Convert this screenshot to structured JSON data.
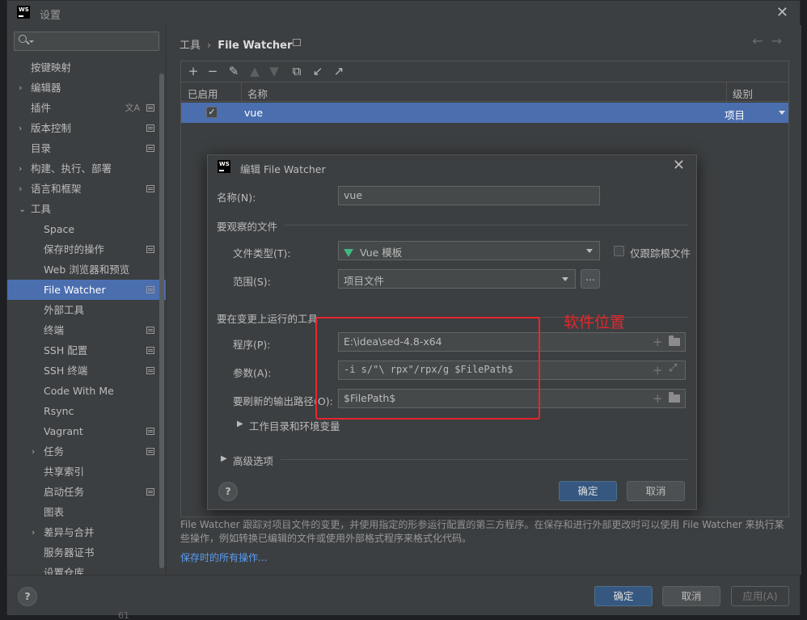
{
  "window": {
    "title": "设置",
    "logo_text": "WS"
  },
  "sidebar": {
    "search_placeholder": "",
    "items": [
      {
        "label": "按键映射",
        "level": 0,
        "arrow": "",
        "project": false
      },
      {
        "label": "编辑器",
        "level": 0,
        "arrow": "›",
        "project": false
      },
      {
        "label": "插件",
        "level": 0,
        "arrow": "",
        "project": true,
        "translate": "文A"
      },
      {
        "label": "版本控制",
        "level": 0,
        "arrow": "›",
        "project": true
      },
      {
        "label": "目录",
        "level": 0,
        "arrow": "",
        "project": true
      },
      {
        "label": "构建、执行、部署",
        "level": 0,
        "arrow": "›",
        "project": false
      },
      {
        "label": "语言和框架",
        "level": 0,
        "arrow": "›",
        "project": true
      },
      {
        "label": "工具",
        "level": 0,
        "arrow": "⌄",
        "project": false
      },
      {
        "label": "Space",
        "level": 1,
        "arrow": "",
        "project": false
      },
      {
        "label": "保存时的操作",
        "level": 1,
        "arrow": "",
        "project": true
      },
      {
        "label": "Web 浏览器和预览",
        "level": 1,
        "arrow": "",
        "project": false
      },
      {
        "label": "File Watcher",
        "level": 1,
        "arrow": "",
        "project": true,
        "selected": true
      },
      {
        "label": "外部工具",
        "level": 1,
        "arrow": "",
        "project": false
      },
      {
        "label": "终端",
        "level": 1,
        "arrow": "",
        "project": true
      },
      {
        "label": "SSH 配置",
        "level": 1,
        "arrow": "",
        "project": true
      },
      {
        "label": "SSH 终端",
        "level": 1,
        "arrow": "",
        "project": true
      },
      {
        "label": "Code With Me",
        "level": 1,
        "arrow": "",
        "project": false
      },
      {
        "label": "Rsync",
        "level": 1,
        "arrow": "",
        "project": false
      },
      {
        "label": "Vagrant",
        "level": 1,
        "arrow": "",
        "project": true
      },
      {
        "label": "任务",
        "level": 1,
        "arrow": "›",
        "project": true
      },
      {
        "label": "共享索引",
        "level": 1,
        "arrow": "",
        "project": false
      },
      {
        "label": "启动任务",
        "level": 1,
        "arrow": "",
        "project": true
      },
      {
        "label": "图表",
        "level": 1,
        "arrow": "",
        "project": false
      },
      {
        "label": "差异与合并",
        "level": 1,
        "arrow": "›",
        "project": false
      },
      {
        "label": "服务器证书",
        "level": 1,
        "arrow": "",
        "project": false
      },
      {
        "label": "设置仓库",
        "level": 1,
        "arrow": "",
        "project": false
      }
    ]
  },
  "header": {
    "crumb_parent": "工具",
    "crumb_sep": "›",
    "crumb_current": "File Watcher",
    "nav_back": "←",
    "nav_forward": "→"
  },
  "table": {
    "toolbar": [
      "+",
      "−",
      "✎",
      "▲",
      "▼",
      "⧉",
      "↙",
      "↗"
    ],
    "columns": {
      "enabled": "已启用",
      "name": "名称",
      "level": "级别"
    },
    "rows": [
      {
        "enabled": true,
        "name": "vue",
        "level": "项目"
      }
    ]
  },
  "description": "File Watcher 跟踪对项目文件的变更，并使用指定的形参运行配置的第三方程序。在保存和进行外部更改时可以使用 File Watcher 来执行某些操作，例如转换已编辑的文件或使用外部格式程序来格式化代码。",
  "save_actions_link": "保存时的所有操作...",
  "footer": {
    "help": "?",
    "ok": "确定",
    "cancel": "取消",
    "apply": "应用(A)"
  },
  "dialog": {
    "title": "编辑 File Watcher",
    "name_label": "名称(N):",
    "name_value": "vue",
    "watch_section": "要观察的文件",
    "filetype_label": "文件类型(T):",
    "filetype_value": "Vue 模板",
    "track_root_label": "仅跟踪根文件",
    "scope_label": "范围(S):",
    "scope_value": "项目文件",
    "scope_more": "...",
    "tool_section": "要在变更上运行的工具",
    "program_label": "程序(P):",
    "program_value": "E:\\idea\\sed-4.8-x64",
    "args_label": "参数(A):",
    "args_value": "-i s/\"\\ rpx\"/rpx/g $FilePath$",
    "output_label": "要刷新的输出路径(O):",
    "output_value": "$FilePath$",
    "workdir_label": "工作目录和环境变量",
    "advanced_label": "高级选项",
    "help": "?",
    "ok": "确定",
    "cancel": "取消"
  },
  "annotation": {
    "text": "软件位置",
    "color": "#e5272d"
  },
  "gutter_text": "61"
}
